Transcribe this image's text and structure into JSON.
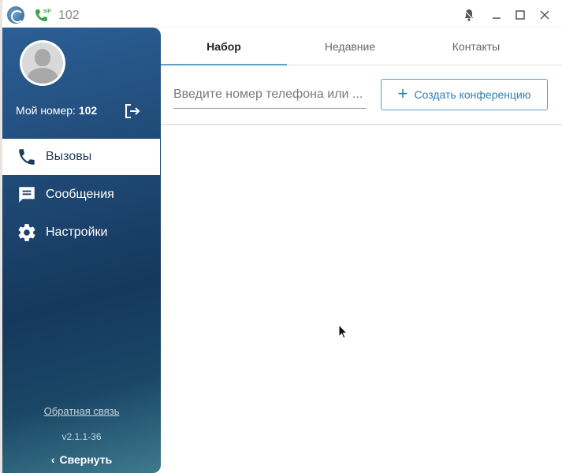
{
  "titlebar": {
    "title": "102",
    "icons": [
      "app-logo-icon",
      "sip-phone-icon",
      "bell-off-icon",
      "minimize-icon",
      "maximize-icon",
      "close-icon"
    ]
  },
  "sidebar": {
    "my_number_label": "Мой номер:",
    "my_number_value": "102",
    "items": [
      {
        "label": "Вызовы",
        "icon": "phone-icon",
        "active": true
      },
      {
        "label": "Сообщения",
        "icon": "message-icon",
        "active": false
      },
      {
        "label": "Настройки",
        "icon": "gear-icon",
        "active": false
      }
    ],
    "feedback": "Обратная связь",
    "version": "v2.1.1-36",
    "collapse": "Свернуть"
  },
  "tabs": [
    {
      "label": "Набор",
      "active": true
    },
    {
      "label": "Недавние",
      "active": false
    },
    {
      "label": "Контакты",
      "active": false
    }
  ],
  "dial": {
    "search_placeholder": "Введите номер телефона или ...",
    "search_value": "",
    "conference_button": "Создать конференцию"
  },
  "colors": {
    "sidebar_top": "#2c5f96",
    "sidebar_mid": "#15385d",
    "accent": "#2f7fb1",
    "tab_underline": "#5aa0c8"
  }
}
